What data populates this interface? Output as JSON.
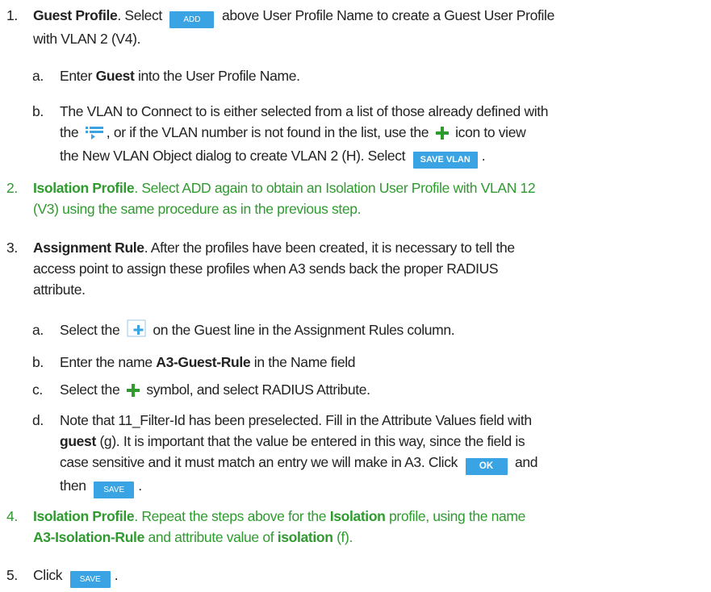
{
  "colors": {
    "accent_green": "#2f9b2f",
    "button_blue": "#3aa3e3"
  },
  "icons": {
    "vlan_list": "list-icon",
    "add": "plus-icon",
    "assignment_rule": "add-rule-icon"
  },
  "steps": [
    {
      "num": "1.",
      "title": "Guest Profile",
      "t1": ". Select",
      "button": "ADD",
      "t2": "above User Profile Name to create a Guest User Profile",
      "t3": "with VLAN 2 (V4).",
      "subs": [
        {
          "num": "a.",
          "t1": "Enter",
          "bold": "Guest",
          "t2": "into the User Profile Name."
        },
        {
          "num": "b.",
          "l1": "The VLAN to Connect to is either selected from a list of those already defined with",
          "l2a": "the",
          "l2b": ", or if the VLAN number is not found in the list, use the",
          "l2c": "icon to view",
          "l3": "the New VLAN Object dialog to create VLAN 2 (H). Select",
          "button": "SAVE VLAN",
          "end": "."
        }
      ]
    },
    {
      "num": "2.",
      "title": "Isolation Profile",
      "l1": ". Select ADD again to obtain an Isolation User Profile with VLAN 12",
      "l2": "(V3) using the same procedure as in the previous step."
    },
    {
      "num": "3.",
      "title": "Assignment Rule",
      "l1": ". After the profiles have been created, it is necessary to tell the",
      "l2": "access point to assign these profiles when A3 sends back the proper RADIUS",
      "l3": "attribute.",
      "subs": [
        {
          "num": "a.",
          "t1": "Select the",
          "t2": "on the Guest line in the Assignment Rules column."
        },
        {
          "num": "b.",
          "t1": "Enter the name",
          "bold": "A3-Guest-Rule",
          "t2": "in the Name field"
        },
        {
          "num": "c.",
          "t1": "Select the",
          "t2": "symbol, and select RADIUS Attribute."
        },
        {
          "num": "d.",
          "l1": "Note that 11_Filter-Id has been preselected. Fill in the Attribute Values field with",
          "bold": "guest",
          "l2": "(g). It is important that the value be entered in this way, since the field is",
          "l3": "case sensitive and it must match an entry we will make in A3. Click",
          "ok": "OK",
          "and": "and",
          "then": "then",
          "save": "SAVE",
          "end": "."
        }
      ]
    },
    {
      "num": "4.",
      "title": "Isolation Profile",
      "l1": ". Repeat the steps above for the",
      "bold1": "Isolation",
      "l1b": "profile, using the name",
      "bold2": "A3-Isolation-Rule",
      "l2": "and attribute value of",
      "bold3": "isolation",
      "l2b": "(f)."
    },
    {
      "num": "5.",
      "t1": "Click",
      "save": "SAVE",
      "end": "."
    }
  ]
}
